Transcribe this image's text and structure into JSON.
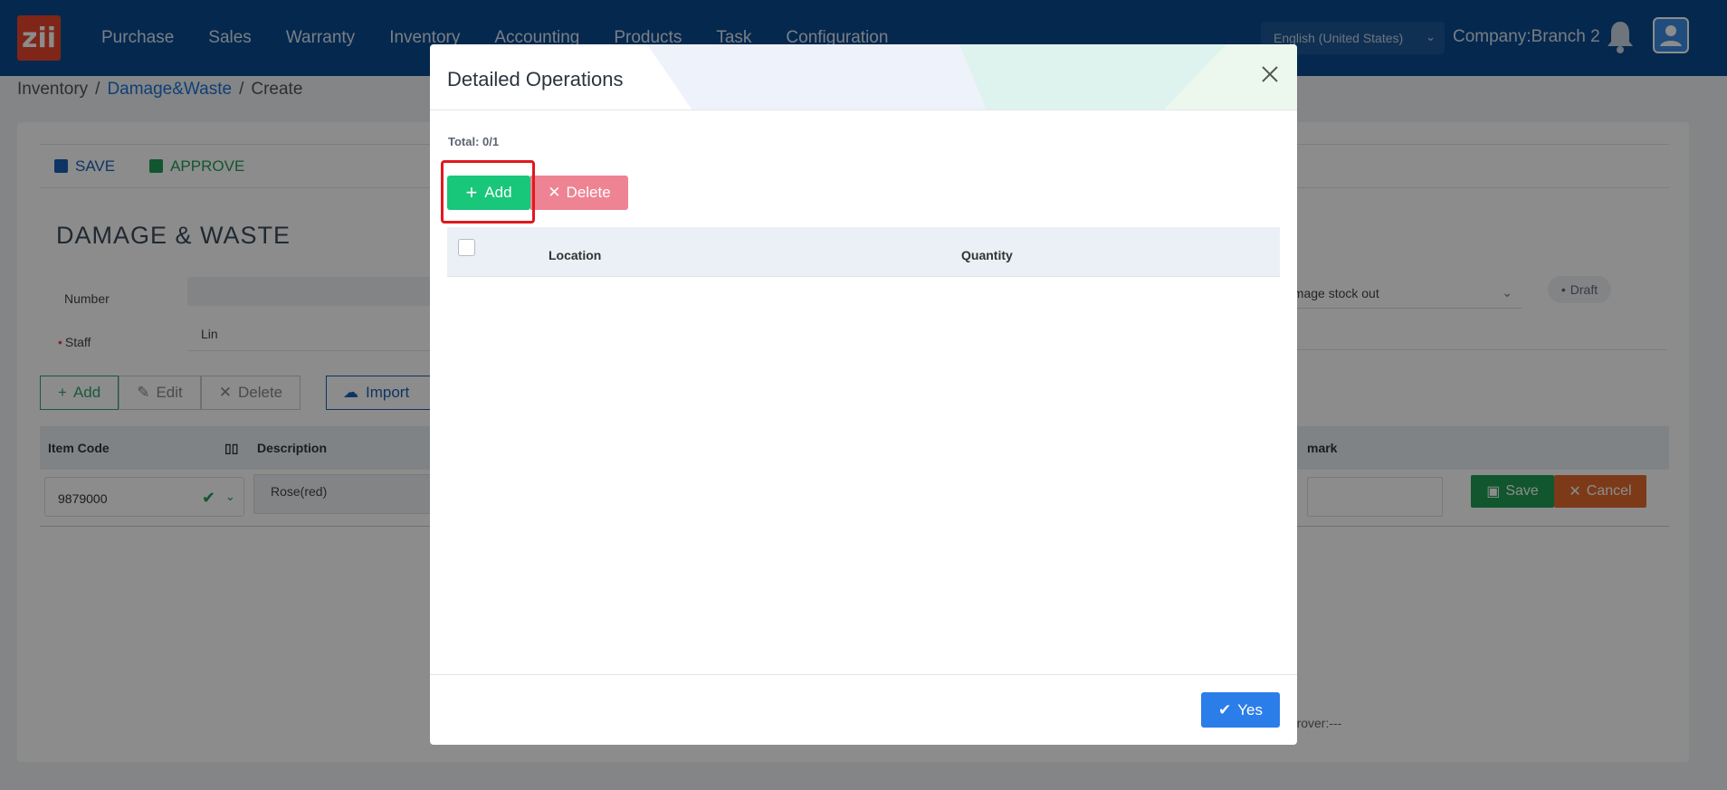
{
  "app": {
    "logo_text": "zii",
    "nav": [
      "Purchase",
      "Sales",
      "Warranty",
      "Inventory",
      "Accounting",
      "Products",
      "Task",
      "Configuration"
    ],
    "language": "English (United States)",
    "company": "Company:Branch 2"
  },
  "breadcrumb": {
    "root": "Inventory",
    "section": "Damage&Waste",
    "current": "Create"
  },
  "toolbar": {
    "save_label": "SAVE",
    "approve_label": "APPROVE"
  },
  "form": {
    "title": "DAMAGE & WASTE",
    "number_label": "Number",
    "staff_label": "Staff",
    "staff_value": "Lin",
    "type_value": "amage stock out",
    "status": "Draft"
  },
  "grid_actions": {
    "add": "Add",
    "edit": "Edit",
    "delete": "Delete",
    "import": "Import"
  },
  "grid": {
    "columns": {
      "item_code": "Item Code",
      "description": "Description",
      "remark": "mark"
    },
    "row": {
      "item_code": "9879000",
      "description": "Rose(red)",
      "save": "Save",
      "cancel": "Cancel"
    },
    "approver": "pprover:---"
  },
  "modal": {
    "title": "Detailed Operations",
    "total": "Total: 0/1",
    "add_label": "Add",
    "delete_label": "Delete",
    "columns": [
      "Location",
      "Quantity"
    ],
    "yes_label": "Yes"
  },
  "colors": {
    "nav_bg": "#0a4a8f",
    "add_green": "#18c77a",
    "delete_pink": "#ee8393",
    "yes_blue": "#2b7de9",
    "highlight_red": "#e0191e"
  }
}
